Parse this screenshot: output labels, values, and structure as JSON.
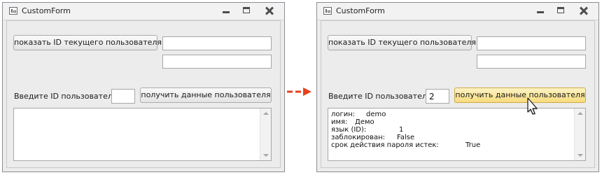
{
  "windows": {
    "before": {
      "title": "CustomForm",
      "show_id_button": "показать ID текущего пользователя",
      "top_field_1": "",
      "top_field_2": "",
      "id_label": "Введите ID пользователя",
      "id_value": "",
      "get_data_button": "получить данные пользователя",
      "output_lines": []
    },
    "after": {
      "title": "CustomForm",
      "show_id_button": "показать ID текущего пользователя",
      "top_field_1": "",
      "top_field_2": "",
      "id_label": "Введите ID пользователя",
      "id_value": "2",
      "get_data_button": "получить данные пользователя",
      "output_lines": [
        {
          "key": "логин:",
          "value": "demo"
        },
        {
          "key": "имя:",
          "value": "Демо"
        },
        {
          "key": "язык (ID):",
          "value": "1"
        },
        {
          "key": "заблокирован:",
          "value": "False"
        },
        {
          "key": "срок действия пароля истек:",
          "value": "True"
        }
      ]
    }
  },
  "colors": {
    "arrow": "#e8401c",
    "hover_button": "#f7dc7e",
    "window_bg": "#ececec"
  },
  "icons": {
    "app": "form-icon",
    "minimize": "minimize-icon",
    "maximize": "maximize-icon",
    "close": "close-icon",
    "transition": "arrow-right-icon",
    "cursor": "mouse-pointer-icon"
  }
}
